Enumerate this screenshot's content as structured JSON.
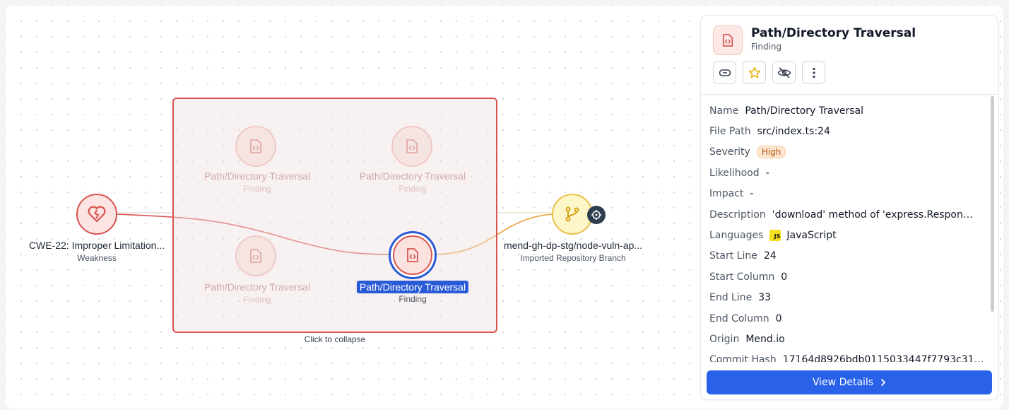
{
  "graph": {
    "nodes": {
      "weakness": {
        "label": "CWE-22: Improper Limitation...",
        "sub": "Weakness",
        "icon": "broken-heart-icon"
      },
      "finding_top_left": {
        "label": "Path/Directory Traversal",
        "sub": "Finding",
        "icon": "code-file-icon"
      },
      "finding_top_right": {
        "label": "Path/Directory Traversal",
        "sub": "Finding",
        "icon": "code-file-icon"
      },
      "finding_bottom_left": {
        "label": "Path/Directory Traversal",
        "sub": "Finding",
        "icon": "code-file-icon"
      },
      "finding_selected": {
        "label": "Path/Directory Traversal",
        "sub": "Finding",
        "icon": "code-file-icon"
      },
      "branch": {
        "label": "mend-gh-dp-stg/node-vuln-ap...",
        "sub": "Imported Repository Branch",
        "icon": "git-branch-icon"
      }
    },
    "group": {
      "collapse_label": "Click to collapse"
    },
    "colors": {
      "finding": "#d9534f",
      "branch": "#e8a33d",
      "selected": "#2a5bd7",
      "edge_weakness": "#d9534f",
      "edge_branch": "#e8a33d"
    }
  },
  "panel": {
    "title": "Path/Directory Traversal",
    "subtitle": "Finding",
    "toolbar": [
      "link-icon",
      "star-icon",
      "eye-off-icon",
      "more-vertical-icon"
    ],
    "rows": [
      {
        "key": "Name",
        "value": "Path/Directory Traversal"
      },
      {
        "key": "File Path",
        "value": "src/index.ts:24"
      },
      {
        "key": "Severity",
        "value": "High"
      },
      {
        "key": "Likelihood",
        "value": "-"
      },
      {
        "key": "Impact",
        "value": "-"
      },
      {
        "key": "Description",
        "value": "'download' method of 'express.Response…"
      },
      {
        "key": "Languages",
        "value": "JavaScript",
        "badge": "JS"
      },
      {
        "key": "Start Line",
        "value": "24"
      },
      {
        "key": "Start Column",
        "value": "0"
      },
      {
        "key": "End Line",
        "value": "33"
      },
      {
        "key": "End Column",
        "value": "0"
      },
      {
        "key": "Origin",
        "value": "Mend.io"
      },
      {
        "key": "Commit Hash",
        "value": "17164d8926bdb0115033447f7793c315…"
      }
    ],
    "view_details": "View Details"
  }
}
